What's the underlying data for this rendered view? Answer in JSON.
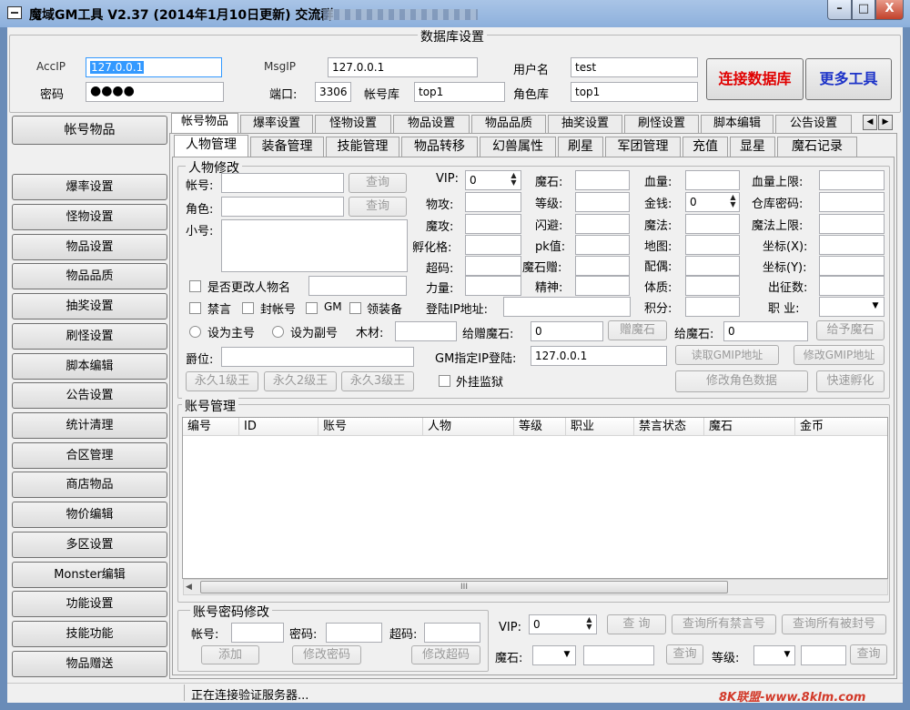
{
  "window": {
    "title": "魔域GM工具 V2.37 (2014年1月10日更新) 交流群",
    "min": "–",
    "max": "□",
    "close": "X"
  },
  "db": {
    "group_title": "数据库设置",
    "accip_label": "AccIP",
    "accip_value": "127.0.0.1",
    "password_label": "密码",
    "password_value": "●●●●",
    "msgip_label": "MsgIP",
    "msgip_value": "127.0.0.1",
    "port_label": "端口:",
    "port_value": "3306",
    "accdb_label": "帐号库",
    "accdb_value": "top1",
    "user_label": "用户名",
    "user_value": "test",
    "roledb_label": "角色库",
    "roledb_value": "top1",
    "connect_button": "连接数据库",
    "more_tools_button": "更多工具"
  },
  "sidebar": {
    "items": [
      {
        "label": "帐号物品"
      },
      {
        "label": "爆率设置"
      },
      {
        "label": "怪物设置"
      },
      {
        "label": "物品设置"
      },
      {
        "label": "物品品质"
      },
      {
        "label": "抽奖设置"
      },
      {
        "label": "刷怪设置"
      },
      {
        "label": "脚本编辑"
      },
      {
        "label": "公告设置"
      },
      {
        "label": "统计清理"
      },
      {
        "label": "合区管理"
      },
      {
        "label": "商店物品"
      },
      {
        "label": "物价编辑"
      },
      {
        "label": "多区设置"
      },
      {
        "label": "Monster编辑"
      },
      {
        "label": "功能设置"
      },
      {
        "label": "技能功能"
      },
      {
        "label": "物品赠送"
      }
    ]
  },
  "main_tabs": {
    "items": [
      {
        "label": "帐号物品"
      },
      {
        "label": "爆率设置"
      },
      {
        "label": "怪物设置"
      },
      {
        "label": "物品设置"
      },
      {
        "label": "物品品质"
      },
      {
        "label": "抽奖设置"
      },
      {
        "label": "刷怪设置"
      },
      {
        "label": "脚本编辑"
      },
      {
        "label": "公告设置"
      }
    ]
  },
  "sub_tabs": {
    "items": [
      {
        "label": "人物管理"
      },
      {
        "label": "装备管理"
      },
      {
        "label": "技能管理"
      },
      {
        "label": "物品转移"
      },
      {
        "label": "幻兽属性"
      },
      {
        "label": "刷星"
      },
      {
        "label": "军团管理"
      },
      {
        "label": "充值"
      },
      {
        "label": "显星"
      },
      {
        "label": "魔石记录"
      }
    ]
  },
  "char": {
    "group_title": "人物修改",
    "account_label": "帐号:",
    "role_label": "角色:",
    "alt_label": "小号:",
    "query_button": "查询",
    "rename_check": "是否更改人物名",
    "mute_check": "禁言",
    "ban_check": "封帐号",
    "gm_check": "GM",
    "gear_check": "领装备",
    "set_main_radio": "设为主号",
    "set_alt_radio": "设为副号",
    "wood_label": "木材:",
    "rank_label": "爵位:",
    "king1_button": "永久1级王",
    "king2_button": "永久2级王",
    "king3_button": "永久3级王",
    "vip_label": "VIP:",
    "vip_value": "0",
    "phys_atk_label": "物攻:",
    "mag_atk_label": "魔攻:",
    "hatch_label": "孵化格:",
    "super_label": "超码:",
    "strength_label": "力量:",
    "gem_label": "魔石:",
    "level_label": "等级:",
    "dodge_label": "闪避:",
    "pk_label": "pk值:",
    "gem_gift_label": "魔石赠:",
    "spirit_label": "精神:",
    "hp_label": "血量:",
    "money_label": "金钱:",
    "money_value": "0",
    "mana_label": "魔法:",
    "map_label": "地图:",
    "spouse_label": "配偶:",
    "physique_label": "体质:",
    "points_label": "积分:",
    "hpmax_label": "血量上限:",
    "wh_pwd_label": "仓库密码:",
    "mpmax_label": "魔法上限:",
    "cx_label": "坐标(X):",
    "cy_label": "坐标(Y):",
    "exp_label": "出征数:",
    "job_label": "职 业:",
    "login_ip_label": "登陆IP地址:",
    "gift_gem_label": "给赠魔石:",
    "gift_gem_value": "0",
    "gift_gem_button": "赠魔石",
    "give_gem_label": "给魔石:",
    "give_gem_value": "0",
    "give_gem_button": "给予魔石",
    "gm_ip_label": "GM指定IP登陆:",
    "gm_ip_value": "127.0.0.1",
    "read_gmip_button": "读取GMIP地址",
    "modify_gmip_button": "修改GMIP地址",
    "jail_check": "外挂监狱",
    "modify_role_button": "修改角色数据",
    "quick_hatch_button": "快速孵化"
  },
  "accounts": {
    "group_title": "账号管理",
    "columns": [
      "编号",
      "ID",
      "账号",
      "人物",
      "等级",
      "职业",
      "禁言状态",
      "魔石",
      "金币"
    ],
    "scroll_thumb": "III"
  },
  "pwd": {
    "group_title": "账号密码修改",
    "account_label": "帐号:",
    "password_label": "密码:",
    "super_label": "超码:",
    "add_button": "添加",
    "modify_pwd_button": "修改密码",
    "modify_super_button": "修改超码"
  },
  "bottom": {
    "vip_label": "VIP:",
    "vip_value": "0",
    "query_button": "查 询",
    "query_muted_button": "查询所有禁言号",
    "query_banned_button": "查询所有被封号",
    "gem_label": "魔石:",
    "query2_button": "查询",
    "level_label": "等级:",
    "query3_button": "查询"
  },
  "status": {
    "text": "正在连接验证服务器..."
  },
  "watermark": "8K联盟-www.8klm.com"
}
